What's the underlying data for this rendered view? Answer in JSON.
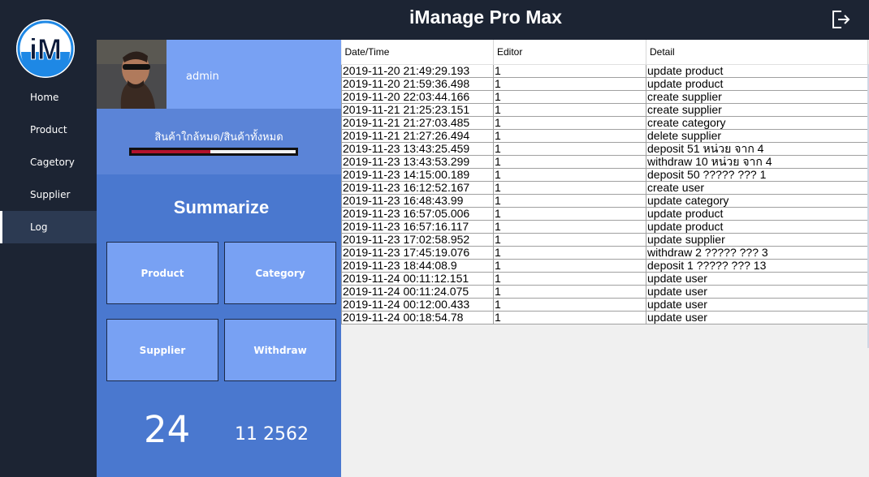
{
  "app": {
    "title": "iManage Pro Max",
    "logo_text": "iM"
  },
  "sidebar": {
    "items": [
      {
        "label": "Home"
      },
      {
        "label": "Product"
      },
      {
        "label": "Cagetory"
      },
      {
        "label": "Supplier"
      },
      {
        "label": "Log"
      }
    ],
    "active": "Log"
  },
  "profile": {
    "username": "admin"
  },
  "stock": {
    "label": "สินค้าใกล้หมด/สินค้าทั้งหมด",
    "ratio": 0.48
  },
  "summary": {
    "title": "Summarize",
    "tiles": [
      {
        "label": "Product"
      },
      {
        "label": "Category"
      },
      {
        "label": "Supplier"
      },
      {
        "label": "Withdraw"
      }
    ],
    "day": "24",
    "month_year": "11 2562"
  },
  "log_table": {
    "columns": [
      "Date/Time",
      "Editor",
      "Detail"
    ],
    "rows": [
      [
        "2019-11-20 21:49:29.193",
        "1",
        "update product"
      ],
      [
        "2019-11-20 21:59:36.498",
        "1",
        "update product"
      ],
      [
        "2019-11-20 22:03:44.166",
        "1",
        "create supplier"
      ],
      [
        "2019-11-21 21:25:23.151",
        "1",
        "create supplier"
      ],
      [
        "2019-11-21 21:27:03.485",
        "1",
        "create category"
      ],
      [
        "2019-11-21 21:27:26.494",
        "1",
        "delete supplier"
      ],
      [
        "2019-11-23 13:43:25.459",
        "1",
        "deposit 51 หน่วย จาก 4"
      ],
      [
        "2019-11-23 13:43:53.299",
        "1",
        "withdraw 10 หน่วย จาก 4"
      ],
      [
        "2019-11-23 14:15:00.189",
        "1",
        "deposit 50 ????? ??? 1"
      ],
      [
        "2019-11-23 16:12:52.167",
        "1",
        "create user"
      ],
      [
        "2019-11-23 16:48:43.99",
        "1",
        "update category"
      ],
      [
        "2019-11-23 16:57:05.006",
        "1",
        "update product"
      ],
      [
        "2019-11-23 16:57:16.117",
        "1",
        "update product"
      ],
      [
        "2019-11-23 17:02:58.952",
        "1",
        "update supplier"
      ],
      [
        "2019-11-23 17:45:19.076",
        "1",
        "withdraw 2 ????? ??? 3"
      ],
      [
        "2019-11-23 18:44:08.9",
        "1",
        "deposit 1 ????? ??? 13"
      ],
      [
        "2019-11-24 00:11:12.151",
        "1",
        "update user"
      ],
      [
        "2019-11-24 00:11:24.075",
        "1",
        "update user"
      ],
      [
        "2019-11-24 00:12:00.433",
        "1",
        "update user"
      ],
      [
        "2019-11-24 00:18:54.78",
        "1",
        "update user"
      ]
    ]
  },
  "icons": {
    "logout": "logout-icon",
    "avatar": "user-photo"
  },
  "colors": {
    "background": "#1c2433",
    "profile": "#78a1f3",
    "stock_panel": "#5b84d7",
    "summary_panel": "#4a78cf",
    "tile": "#78a1f3",
    "progress_fill": "#b3122c",
    "logo_accent": "#1e88e5"
  }
}
